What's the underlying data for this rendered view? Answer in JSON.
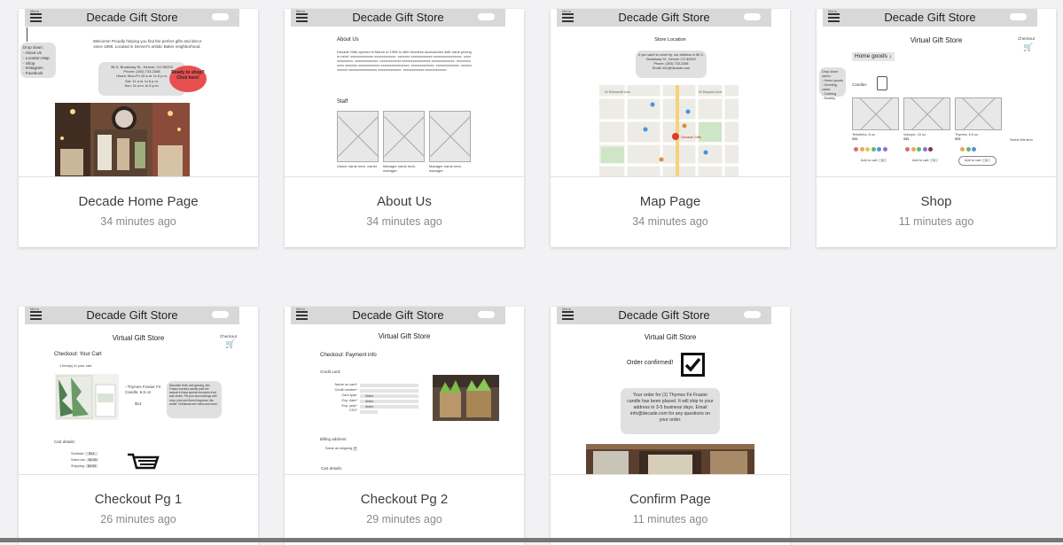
{
  "cards": [
    {
      "title": "Decade Home Page",
      "time": "34 minutes ago"
    },
    {
      "title": "About Us",
      "time": "34 minutes ago"
    },
    {
      "title": "Map Page",
      "time": "34 minutes ago"
    },
    {
      "title": "Shop",
      "time": "11 minutes ago"
    },
    {
      "title": "Checkout Pg 1",
      "time": "26 minutes ago"
    },
    {
      "title": "Checkout Pg 2",
      "time": "29 minutes ago"
    },
    {
      "title": "Confirm Page",
      "time": "11 minutes ago"
    }
  ],
  "wireframe": {
    "store_name": "Decade Gift Store",
    "menu_label": "Menu",
    "search_label": "Search",
    "virtual_store": "Virtual Gift Store",
    "checkout_label": "Checkout",
    "home": {
      "drop_down": "Drop down:\n- About Us\n- Location Map\n- Shop\n- Instagram\n- Facebook",
      "welcome": "Welcome! Proudly helping you find the perfect gifts and decor since 1998. Located in Denver's artistic Baker neighborhood.",
      "address": "56 S. Broadway St., Denver, CO 80209\nPhone: (303) 733-2288\nHours: Mon-Fri 10 a.m. to 6 p.m.\nSat: 11 a.m. to 6 p.m.\nSun: 11 a.m. to 5 p.m.",
      "cta": "Ready to shop? Click here!"
    },
    "about": {
      "heading": "About Us",
      "body": "Decade Gifts opened in March of 1998 to offer timeless accessories with value pricing in mind. xxxxxxxxxxxxx xxxxxxxxxxxx. xxxxxxx xxxxxxxxxxxx xxxxxxxxxxxxxxxx. xxxxxxxxxxxxx. xxxxxxxxxxxxx. xxxxxxxxxxxx xxxxxxxxxxxxxxxx xxxxxxxxxxxxx. xxxxxxxxxxxx xxxxxxx xxxxxxxxxxxx xxxxxxxxxxxxxxxx. xxxxxxxxxxxxx. xxxxxxxxxxxxx. xxxxxxxxxxxx xxxxxxxxxxxxxxxx xxxxxxxxxxxxx. xxxxxxxxxxxx xxxxxxxxxxxx.",
      "staff": "Staff",
      "staff_names": [
        "Owner name here, owner",
        "Manager name here, manager",
        "Manager name here, manager"
      ]
    },
    "map": {
      "heading": "Store Location",
      "info": "If you want to come by, our address is 56 S. Broadway St., Denver CO 80209\nPhone: (303) 733-2288\nEmail: info@decade.com",
      "streets": [
        "W Ellsworth Ave",
        "W Bayaud Ave",
        "Decade Gifts"
      ]
    },
    "shop": {
      "drop_down": "Drop down menu:\n- Home goods\n- Greeting cards\n- Clothing\n- Jewelry",
      "category": "Home goods ↓",
      "sub": "Candles",
      "products": [
        {
          "name": "Tellothera, 8 oz.",
          "price": "$$$"
        },
        {
          "name": "Volvupe, 16 oz.",
          "price": "$$$"
        },
        {
          "name": "Thymes, 6.5 oz.",
          "price": "$$$"
        }
      ],
      "add_to_cart": "Add to cart:",
      "qty": "1",
      "select_note": "Select this item",
      "swatches": [
        "#e06b6b",
        "#e8a85a",
        "#e6c94a",
        "#5dbb6b",
        "#5a8fd6",
        "#9b6bd6",
        "#7a3b3b"
      ]
    },
    "checkout1": {
      "heading": "Checkout: Your Cart",
      "items": "1 item(s) in your cart",
      "product": "- Thymes Frasier Fir Candle, 6.5 oz.",
      "price": "$14",
      "desc": "Mountain fresh and glowing, this Frasier scented candle puts the season's finest special moments front and center. Fill your surroundings with crisp, pine and forest fragrance this winter. Christmas tree notes and more.",
      "cart_details": "Cart details:",
      "subtotal": "Subtotal:",
      "subtotal_val": "$14",
      "tax": "Sales tax:",
      "tax_val": "$0.95",
      "shipping": "Shipping:",
      "shipping_val": "$4.95"
    },
    "checkout2": {
      "heading": "Checkout: Payment info",
      "credit_card": "Credit card:",
      "fields": [
        "Name on card*",
        "Credit number*",
        "Card type:",
        "Exp. date*",
        "Exp. year*",
        "CSV*"
      ],
      "select": "Select",
      "billing": "Billing address:",
      "same_as": "Same as shipping",
      "cart_details": "Cart details:"
    },
    "confirm": {
      "heading": "Order confirmed!",
      "message": "Your order for (1) Thymes Fir Frasier candle has been placed. It will ship to your address in 3-5 business days. Email info@decade.com for any questions on your order."
    }
  }
}
